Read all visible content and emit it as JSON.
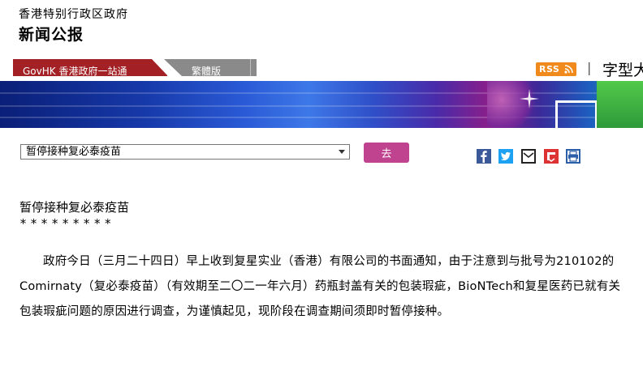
{
  "header": {
    "gov_name": "香港特别行政区政府",
    "section_title": "新闻公报"
  },
  "topnav": {
    "govhk_tab": "GovHK 香港政府一站通",
    "trad_tab": "繁體版",
    "rss_label": "RSS",
    "separator": "|",
    "font_size_label": "字型大"
  },
  "colors": {
    "govhk_tab_bg": "#a32024",
    "trad_tab_bg": "#8a8a8a",
    "rss_bg": "#f08a1c",
    "go_button_bg": "#c0438f"
  },
  "toolbar": {
    "article_select_value": "暂停接种复必泰疫苗",
    "go_button_label": "去"
  },
  "share_icons": [
    "facebook-icon",
    "twitter-icon",
    "email-icon",
    "flipboard-icon",
    "print-icon"
  ],
  "article": {
    "title": "暂停接种复必泰疫苗",
    "stars": "*********",
    "body": "政府今日（三月二十四日）早上收到复星实业（香港）有限公司的书面通知，由于注意到与批号为210102的Comirnaty（复必泰疫苗）（有效期至二〇二一年六月）药瓶封盖有关的包装瑕疵，BioNTech和复星医药已就有关包装瑕疵问题的原因进行调查，为谨慎起见，现阶段在调查期间须即时暂停接种。"
  }
}
